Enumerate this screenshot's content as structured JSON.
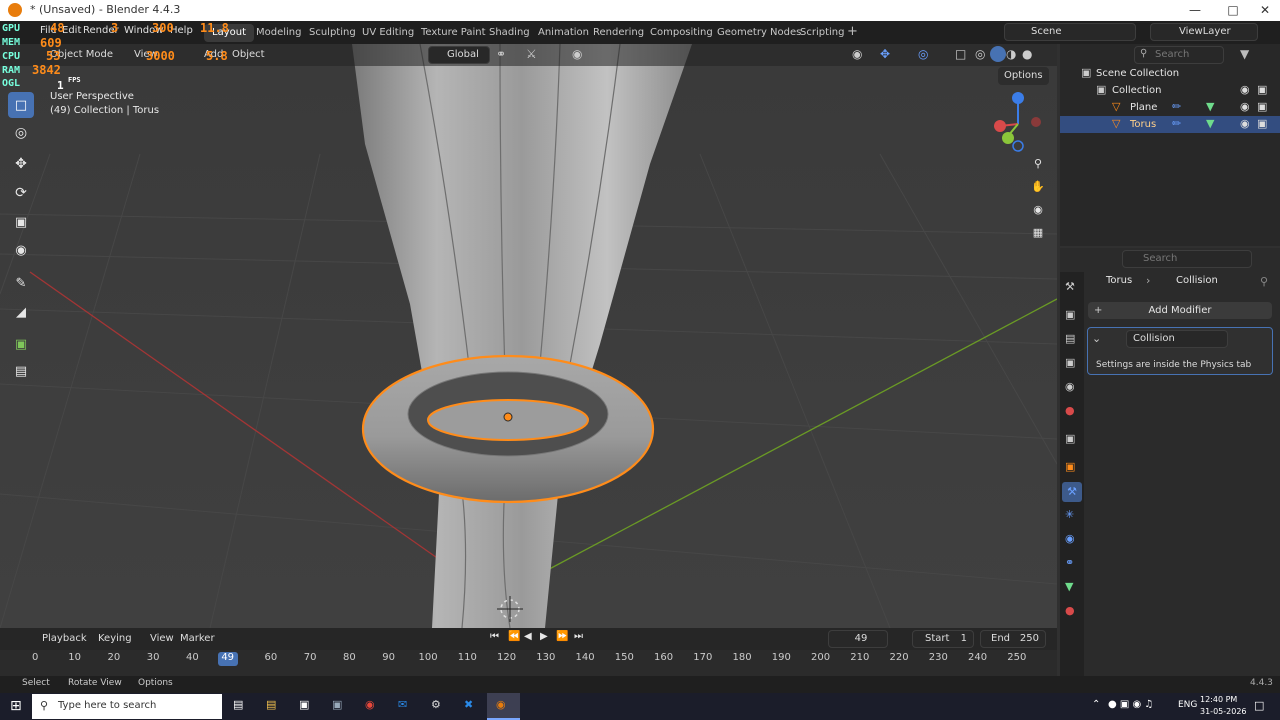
{
  "window": {
    "title": "* (Unsaved) - Blender 4.4.3"
  },
  "menu": [
    "File",
    "Edit",
    "Render",
    "Window",
    "Help"
  ],
  "workspaces": [
    {
      "label": "Layout",
      "active": true
    },
    {
      "label": "Modeling"
    },
    {
      "label": "Sculpting"
    },
    {
      "label": "UV Editing"
    },
    {
      "label": "Texture Paint"
    },
    {
      "label": "Shading"
    },
    {
      "label": "Animation"
    },
    {
      "label": "Rendering"
    },
    {
      "label": "Compositing"
    },
    {
      "label": "Geometry Nodes"
    },
    {
      "label": "Scripting"
    }
  ],
  "scene": {
    "name": "Scene"
  },
  "viewlayer": {
    "name": "ViewLayer"
  },
  "viewport": {
    "mode": "Object Mode",
    "view": "View",
    "add": "Add",
    "object": "Object",
    "transform_orientation": "Global",
    "options": "Options",
    "perspective": "User Perspective",
    "context": "(49) Collection | Torus"
  },
  "hud_overlay": {
    "temp": "48",
    "temp2": "300",
    "mhz": "11.8",
    "mem": "609",
    "cpu": "53",
    "cpu_mhz": "3000",
    "cpu_v": "5.8",
    "ram": "3842",
    "fps_label": "FPS",
    "frame": "1",
    "gpu_pct": "3"
  },
  "outliner": {
    "search_placeholder": "Search",
    "items": [
      {
        "label": "Scene Collection"
      },
      {
        "label": "Collection"
      },
      {
        "label": "Plane"
      },
      {
        "label": "Torus",
        "selected": true
      }
    ]
  },
  "properties": {
    "search_placeholder": "Search",
    "breadcrumb_object": "Torus",
    "breadcrumb_modifier": "Collision",
    "add_modifier": "Add Modifier",
    "modifier_name": "Collision",
    "modifier_note": "Settings are inside the Physics tab"
  },
  "timeline": {
    "playback": "Playback",
    "keying": "Keying",
    "view": "View",
    "marker": "Marker",
    "current_frame": "49",
    "start_label": "Start",
    "start": "1",
    "end_label": "End",
    "end": "250",
    "ticks": [
      "0",
      "10",
      "20",
      "30",
      "40",
      "49",
      "60",
      "70",
      "80",
      "90",
      "100",
      "110",
      "120",
      "130",
      "140",
      "150",
      "160",
      "170",
      "180",
      "190",
      "200",
      "210",
      "220",
      "230",
      "240",
      "250"
    ]
  },
  "statusbar": {
    "select": "Select",
    "rotate": "Rotate View",
    "options": "Options",
    "version": "4.4.3"
  },
  "taskbar": {
    "search_placeholder": "Type here to search",
    "lang": "ENG",
    "time": "12:40 PM",
    "date": "31-05-2026"
  },
  "colors": {
    "accent": "#4772b3",
    "selection": "#ff8c1a",
    "x_axis": "#a33535",
    "y_axis": "#6a9a25"
  }
}
